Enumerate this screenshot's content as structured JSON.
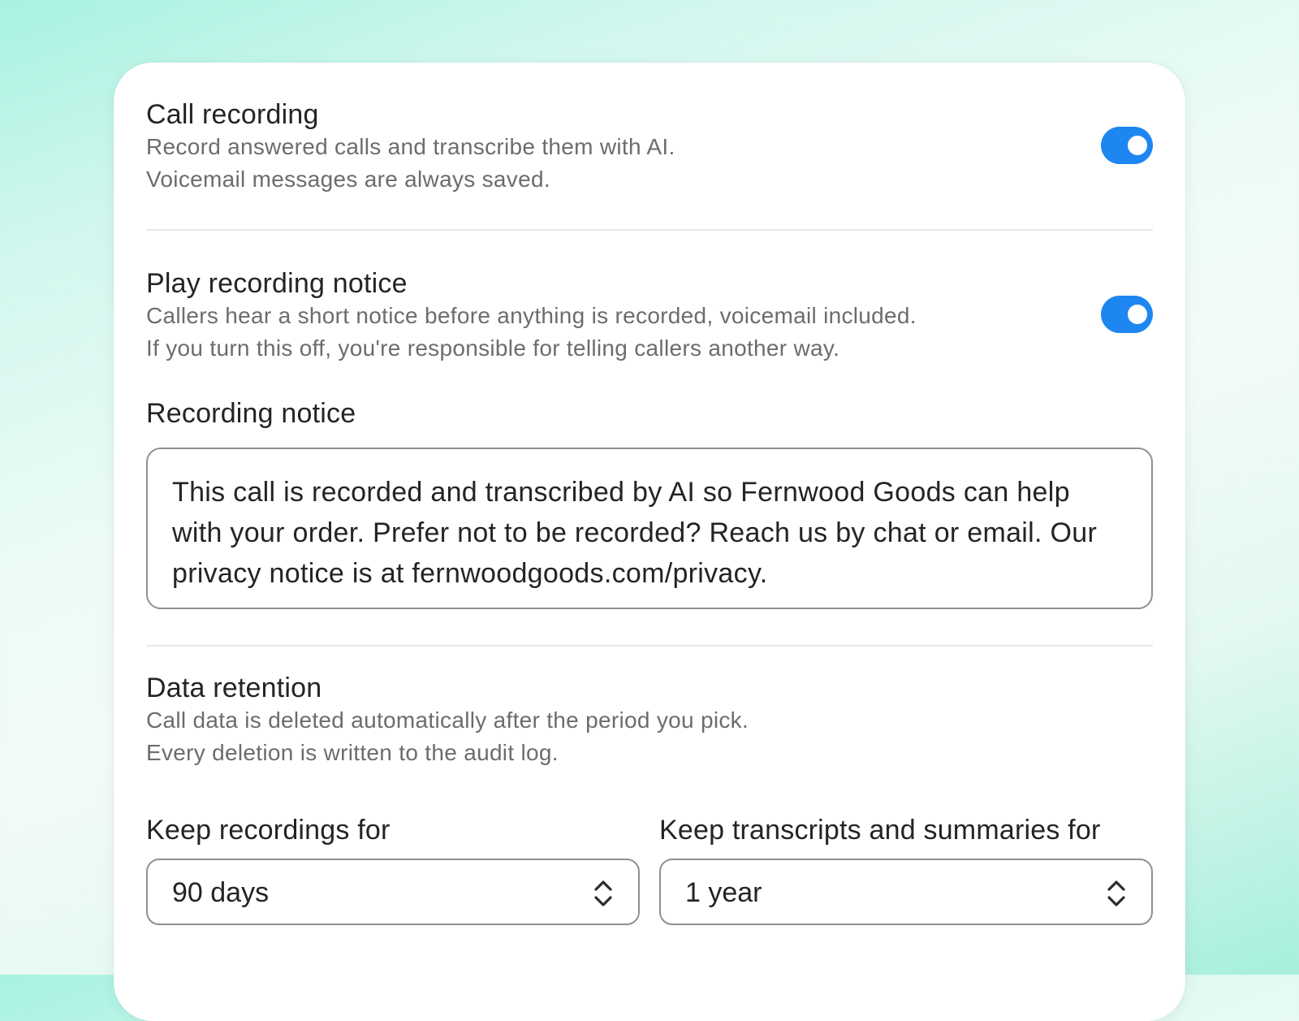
{
  "call_recording": {
    "title": "Call recording",
    "desc_line1": "Record answered calls and transcribe them with AI.",
    "desc_line2": "Voicemail messages are always saved.",
    "enabled": true
  },
  "recording_notice_toggle": {
    "title": "Play recording notice",
    "desc_line1": "Callers hear a short notice before anything is recorded, voicemail included.",
    "desc_line2": "If you turn this off, you're responsible for telling callers another way.",
    "enabled": true
  },
  "recording_notice": {
    "label": "Recording notice",
    "text": "This call is recorded and transcribed by AI so Fernwood Goods can help with your order. Prefer not to be recorded? Reach us by chat or email. Our privacy notice is at fernwoodgoods.com/privacy."
  },
  "data_retention": {
    "title": "Data retention",
    "desc_line1": "Call data is deleted automatically after the period you pick.",
    "desc_line2": "Every deletion is written to the audit log.",
    "recordings_label": "Keep recordings for",
    "recordings_value": "90 days",
    "transcripts_label": "Keep transcripts and summaries for",
    "transcripts_value": "1 year"
  },
  "colors": {
    "accent": "#1e86f0",
    "text": "#222426",
    "muted": "#6a6d70",
    "border": "#8d9094"
  },
  "icons": {
    "select_indicator": "chevron-up-down-icon"
  }
}
